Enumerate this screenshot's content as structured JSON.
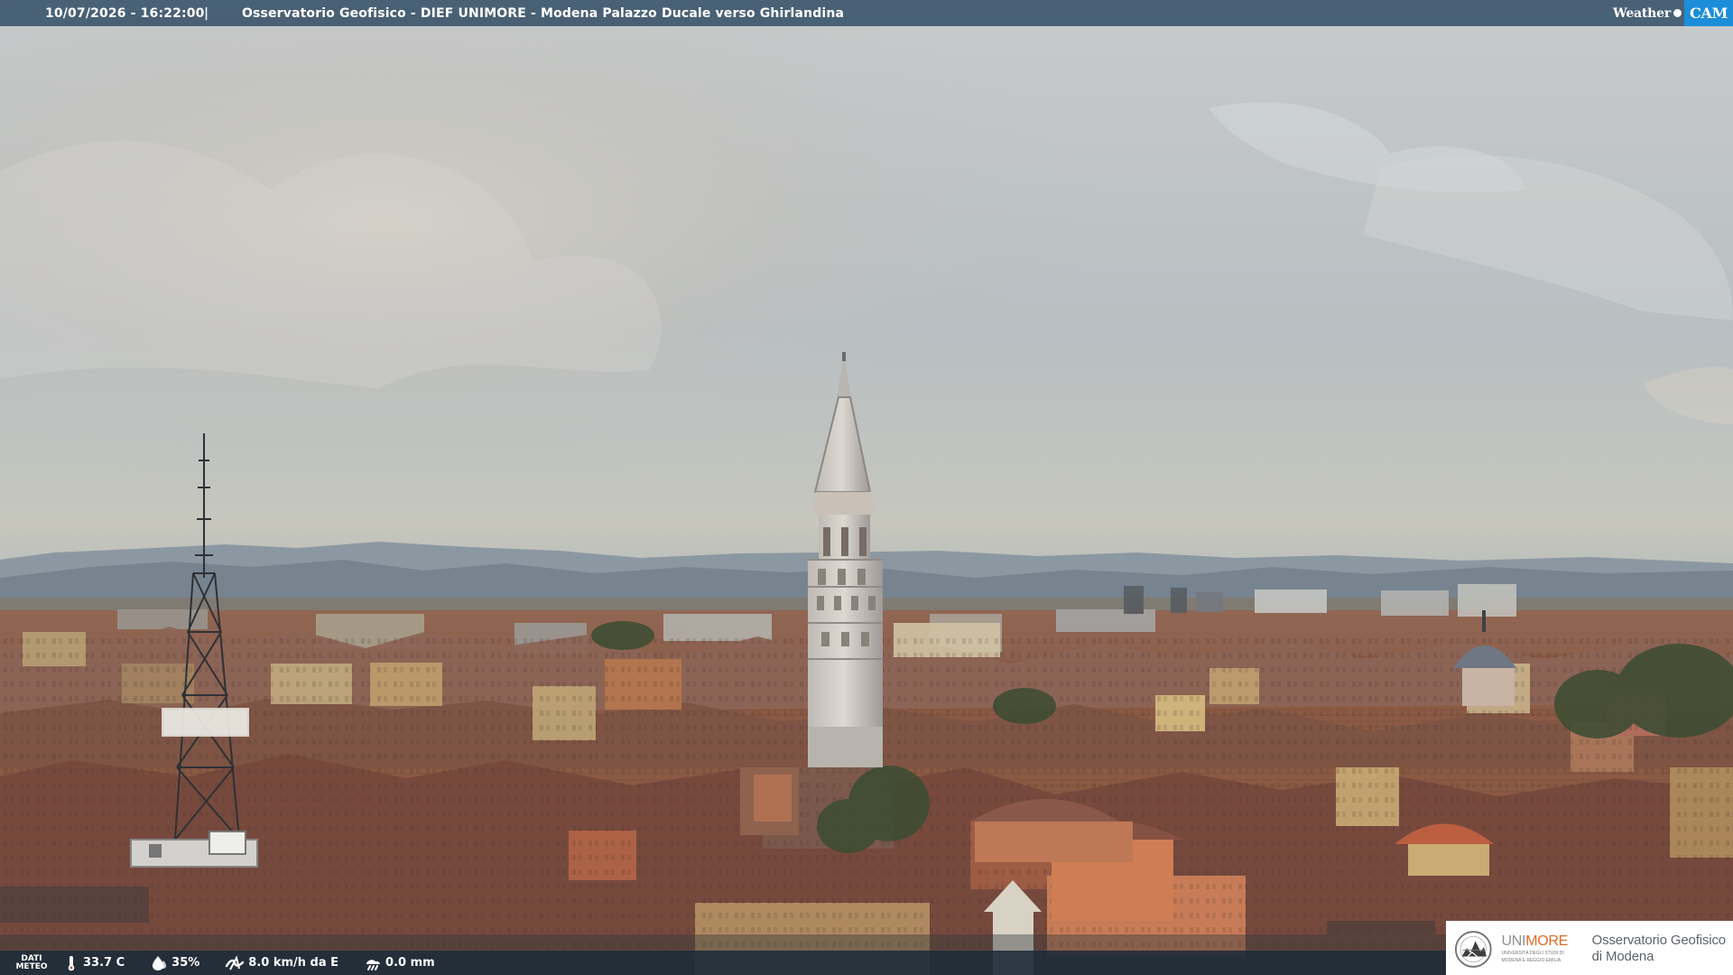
{
  "overlay": {
    "timestamp": "10/07/2026 - 16:22:00",
    "separator": "|",
    "title": "Osservatorio Geofisico - DIEF UNIMORE - Modena Palazzo Ducale verso Ghirlandina"
  },
  "brand": {
    "weather": "Weather",
    "cam": "CAM"
  },
  "weather": {
    "dati": "DATI",
    "meteo": "METEO",
    "temperature": "33.7 C",
    "humidity": "35%",
    "wind": "8.0 km/h da E",
    "rain": "0.0 mm",
    "icons": [
      "thermometer-icon",
      "humidity-drop-icon",
      "wind-icon",
      "rain-icon"
    ]
  },
  "logo": {
    "uni": "UNI",
    "more": "MORE",
    "sub_line_1": "UNIVERSITÀ DEGLI STUDI DI",
    "sub_line_2": "MODENA E REGGIO EMILIA",
    "observatory_line_1": "Osservatorio Geofisico",
    "observatory_line_2": "di Modena"
  },
  "colors": {
    "top_bar": "#385269",
    "bottom_bar": "#1c2b39",
    "cam_badge": "#1c8dd9",
    "unimore_accent": "#d96c27",
    "sky": "#b8bdbd",
    "roofs": "#8c5b42"
  }
}
